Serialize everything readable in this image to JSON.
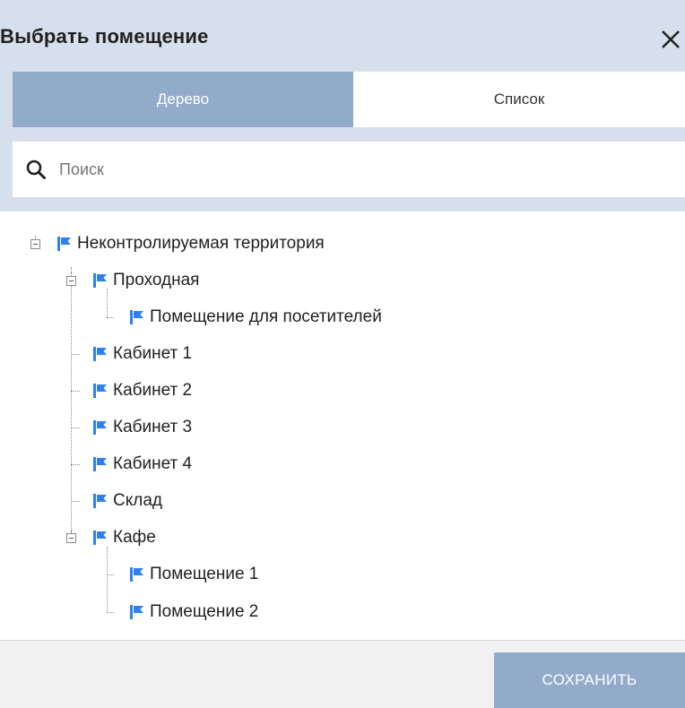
{
  "dialog": {
    "title": "Выбрать помещение",
    "close_icon": "close-icon"
  },
  "tabs": [
    {
      "label": "Дерево",
      "active": true
    },
    {
      "label": "Список",
      "active": false
    }
  ],
  "search": {
    "placeholder": "Поиск",
    "value": "",
    "icon": "search-icon"
  },
  "tree": {
    "icon": "flag-icon",
    "nodes": [
      {
        "label": "Неконтролируемая территория",
        "expanded": true,
        "depth": 0
      },
      {
        "label": "Проходная",
        "expanded": true,
        "depth": 1
      },
      {
        "label": "Помещение для посетителей",
        "depth": 2
      },
      {
        "label": "Кабинет 1",
        "depth": 1
      },
      {
        "label": "Кабинет 2",
        "depth": 1
      },
      {
        "label": "Кабинет 3",
        "depth": 1
      },
      {
        "label": "Кабинет 4",
        "depth": 1
      },
      {
        "label": "Склад",
        "depth": 1
      },
      {
        "label": "Кафе",
        "expanded": true,
        "depth": 1
      },
      {
        "label": "Помещение 1",
        "depth": 2
      },
      {
        "label": "Помещение 2",
        "depth": 2
      }
    ]
  },
  "footer": {
    "save_label": "СОХРАНИТЬ"
  },
  "colors": {
    "header_bg": "#d6e0ec",
    "accent": "#93abcb",
    "flag": "#2f80ed"
  }
}
